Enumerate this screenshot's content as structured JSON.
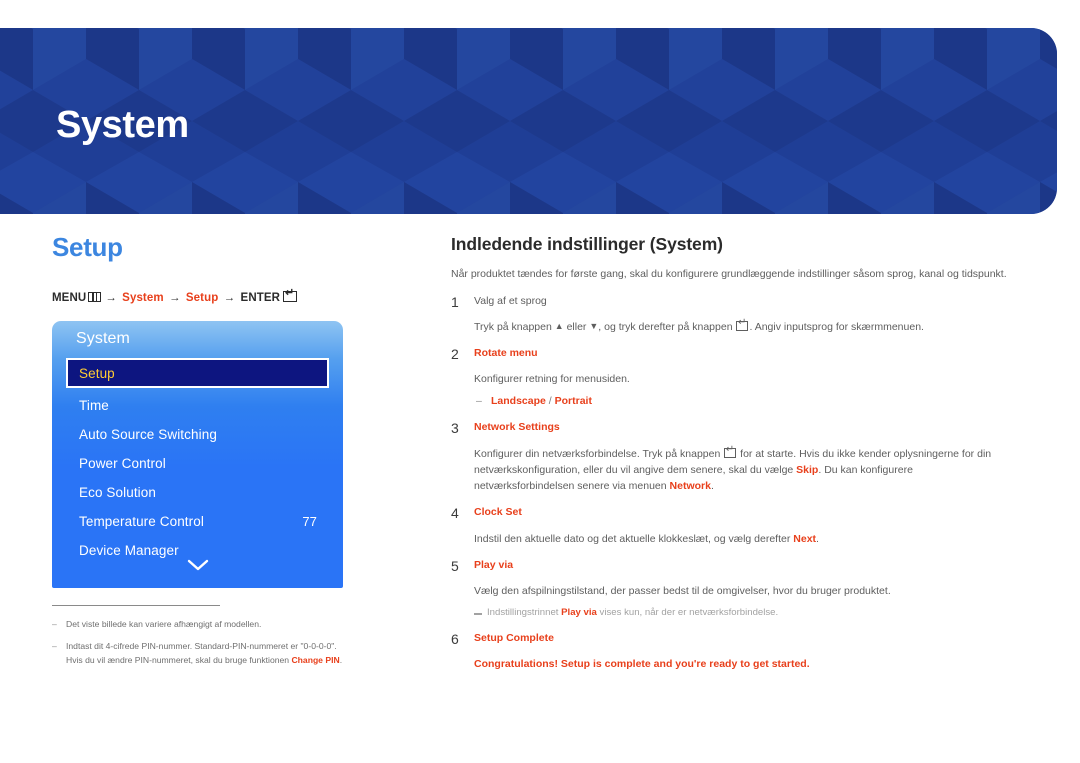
{
  "header": {
    "title": "System",
    "background_color": "#1f3e96"
  },
  "left": {
    "section_title": "Setup",
    "breadcrumb": {
      "menu_label": "MENU",
      "menu_icon": "menu-bars-icon",
      "arrow": "→",
      "crumb1": "System",
      "crumb2": "Setup",
      "enter_label": "ENTER",
      "enter_icon": "enter-key-icon"
    },
    "osd": {
      "title": "System",
      "items": [
        {
          "label": "Setup",
          "value": "",
          "selected": true
        },
        {
          "label": "Time",
          "value": "",
          "selected": false
        },
        {
          "label": "Auto Source Switching",
          "value": "",
          "selected": false
        },
        {
          "label": "Power Control",
          "value": "",
          "selected": false
        },
        {
          "label": "Eco Solution",
          "value": "",
          "selected": false
        },
        {
          "label": "Temperature Control",
          "value": "77",
          "selected": false
        },
        {
          "label": "Device Manager",
          "value": "",
          "selected": false
        }
      ],
      "scroll_icon": "chevron-down-icon",
      "selected_text_color": "#ffcc33",
      "selected_bg_color": "#0d1580"
    },
    "footnotes": [
      {
        "text": "Det viste billede kan variere afhængigt af modellen.",
        "highlight": ""
      },
      {
        "text_before": "Indtast dit 4-cifrede PIN-nummer. Standard-PIN-nummeret er \"0-0-0-0\". Hvis du vil ændre PIN-nummeret, skal du bruge funktionen ",
        "highlight": "Change PIN",
        "text_after": "."
      }
    ]
  },
  "right": {
    "title": "Indledende indstillinger (System)",
    "intro": "Når produktet tændes for første gang, skal du konfigurere grundlæggende indstillinger såsom sprog, kanal og tidspunkt.",
    "steps": [
      {
        "num": "1",
        "head": "Valg af et sprog",
        "head_red": false,
        "desc_before": "Tryk på knappen ",
        "desc_mid": " eller ",
        "desc_after": ", og tryk derefter på knappen ",
        "desc_end": ". Angiv inputsprog for skærmmenuen.",
        "up_arrow": "▲",
        "down_arrow": "▼"
      },
      {
        "num": "2",
        "head": "Rotate menu",
        "head_red": true,
        "desc": "Konfigurer retning for menusiden.",
        "sub_option_1": "Landscape",
        "sub_sep": " / ",
        "sub_option_2": "Portrait"
      },
      {
        "num": "3",
        "head": "Network Settings",
        "head_red": true,
        "desc_p1": "Konfigurer din netværksforbindelse. Tryk på knappen ",
        "desc_p2": " for at starte. Hvis du ikke kender oplysningerne for din netværkskonfiguration, eller du vil angive dem senere, skal du vælge ",
        "hl1": "Skip",
        "desc_p3": ". Du kan konfigurere netværksforbindelsen senere via menuen ",
        "hl2": "Network",
        "desc_p4": "."
      },
      {
        "num": "4",
        "head": "Clock Set",
        "head_red": true,
        "desc_p1": "Indstil den aktuelle dato og det aktuelle klokkeslæt, og vælg derefter ",
        "hl1": "Next",
        "desc_p2": "."
      },
      {
        "num": "5",
        "head": "Play via",
        "head_red": true,
        "desc": "Vælg den afspilningstilstand, der passer bedst til de omgivelser, hvor du bruger produktet.",
        "note_p1": "Indstillingstrinnet ",
        "note_hl": "Play via",
        "note_p2": " vises kun, når der er netværksforbindelse."
      },
      {
        "num": "6",
        "head": "Setup Complete",
        "head_red": true,
        "congrats": "Congratulations! Setup is complete and you're ready to get started."
      }
    ]
  },
  "colors": {
    "accent_red": "#e8401c",
    "accent_blue": "#3c86e0",
    "osd_blue": "#2a74f6"
  }
}
